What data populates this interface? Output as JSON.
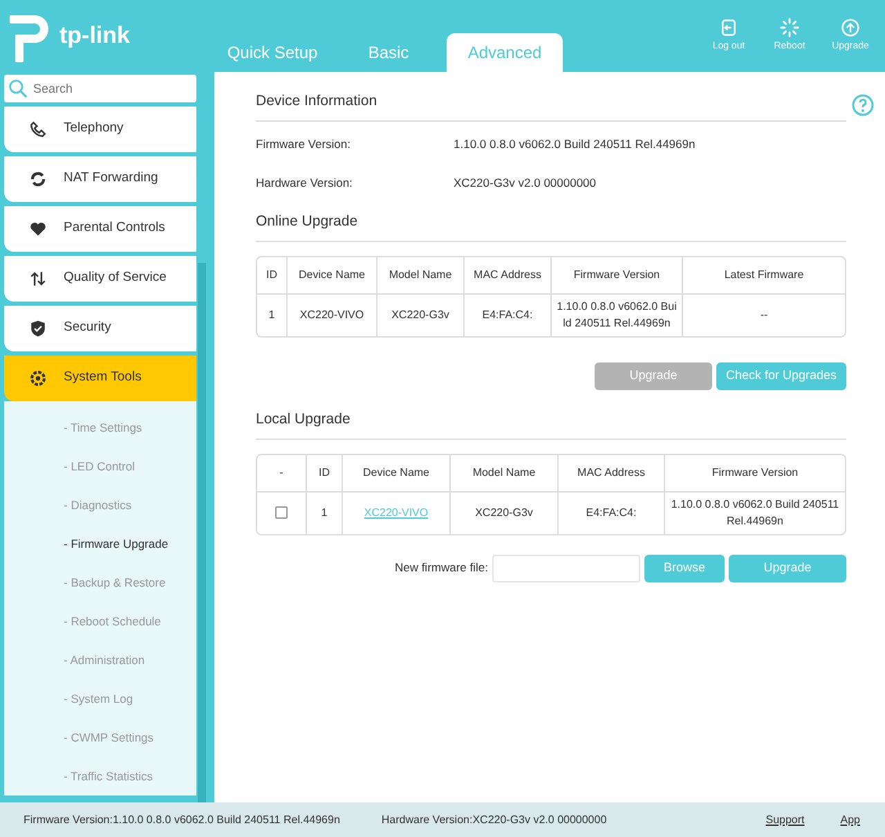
{
  "header": {
    "logo_text": "tp-link",
    "tabs": [
      {
        "label": "Quick Setup",
        "selected": false
      },
      {
        "label": "Basic",
        "selected": false
      },
      {
        "label": "Advanced",
        "selected": true
      }
    ],
    "actions": [
      {
        "label": "Log out",
        "kind": "logout"
      },
      {
        "label": "Reboot",
        "kind": "reboot"
      },
      {
        "label": "Upgrade",
        "kind": "upgrade"
      }
    ]
  },
  "sidebar": {
    "search": {
      "placeholder": "Search"
    },
    "items": [
      {
        "label": "Telephony",
        "kind": "phone",
        "selected": false
      },
      {
        "label": "NAT Forwarding",
        "kind": "nat",
        "selected": false
      },
      {
        "label": "Parental Controls",
        "kind": "heart",
        "selected": false
      },
      {
        "label": "Quality of Service",
        "kind": "qos",
        "selected": false
      },
      {
        "label": "Security",
        "kind": "shield",
        "selected": false
      },
      {
        "label": "System Tools",
        "kind": "gear",
        "selected": true,
        "children": [
          {
            "label": "- Time Settings",
            "selected": false
          },
          {
            "label": "- LED Control",
            "selected": false
          },
          {
            "label": "- Diagnostics",
            "selected": false
          },
          {
            "label": "- Firmware Upgrade",
            "selected": true
          },
          {
            "label": "- Backup & Restore",
            "selected": false
          },
          {
            "label": "- Reboot Schedule",
            "selected": false
          },
          {
            "label": "- Administration",
            "selected": false
          },
          {
            "label": "- System Log",
            "selected": false
          },
          {
            "label": "- CWMP Settings",
            "selected": false
          },
          {
            "label": "- Traffic Statistics",
            "selected": false
          }
        ]
      }
    ]
  },
  "device_info": {
    "title": "Device Information",
    "fields": [
      {
        "label": "Firmware Version:",
        "value": "1.10.0 0.8.0 v6062.0 Build 240511 Rel.44969n"
      },
      {
        "label": "Hardware Version:",
        "value": "XC220-G3v v2.0 00000000"
      }
    ]
  },
  "online_upgrade": {
    "title": "Online Upgrade",
    "columns": [
      "ID",
      "Device Name",
      "Model Name",
      "MAC Address",
      "Firmware Version",
      "Latest Firmware"
    ],
    "rows": [
      [
        "1",
        "XC220-VIVO",
        "XC220-G3v",
        "E4:FA:C4:",
        "1.10.0 0.8.0 v6062.0 Build 240511 Rel.44969n",
        "--"
      ]
    ],
    "buttons": [
      {
        "label": "Upgrade",
        "disabled": true
      },
      {
        "label": "Check for Upgrades",
        "disabled": false
      }
    ]
  },
  "local_upgrade": {
    "title": "Local Upgrade",
    "columns": [
      "-",
      "ID",
      "Device Name",
      "Model Name",
      "MAC Address",
      "Firmware Version"
    ],
    "rows": [
      {
        "checked": false,
        "cells": [
          "",
          "1",
          "XC220-VIVO",
          "XC220-G3v",
          "E4:FA:C4:",
          "1.10.0 0.8.0 v6062.0 Build 240511 Rel.44969n"
        ]
      }
    ],
    "file_label": "New firmware file:",
    "buttons": [
      {
        "label": "Browse",
        "disabled": false
      },
      {
        "label": "Upgrade",
        "disabled": false
      }
    ]
  },
  "footer": {
    "firmware": "Firmware Version:1.10.0 0.8.0 v6062.0 Build 240511 Rel.44969n",
    "hardware": "Hardware Version:XC220-G3v v2.0 00000000",
    "links": [
      "Support",
      "App"
    ]
  }
}
